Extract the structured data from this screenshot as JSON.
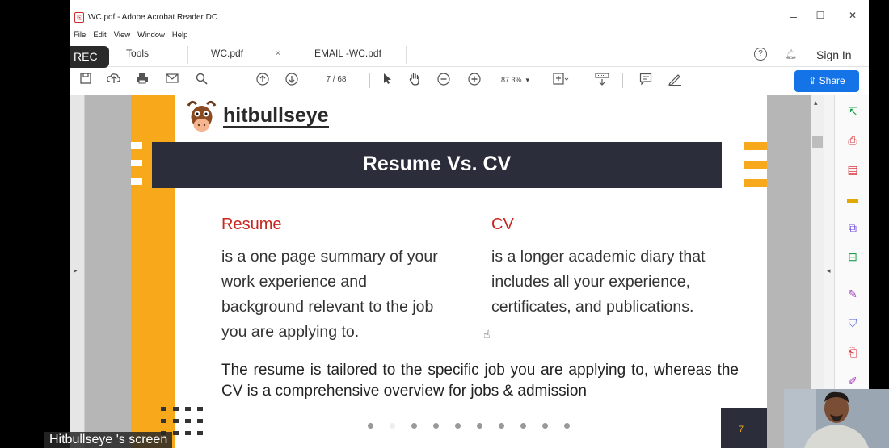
{
  "window": {
    "title": "WC.pdf - Adobe Acrobat Reader DC",
    "menu": [
      "File",
      "Edit",
      "View",
      "Window",
      "Help"
    ],
    "minimize_glyph": "–",
    "maximize_glyph": "☐",
    "close_glyph": "✕"
  },
  "recording": {
    "label": "REC"
  },
  "tabs": {
    "tools_label": "Tools",
    "items": [
      {
        "label": "WC.pdf",
        "close": "×"
      },
      {
        "label": "EMAIL -WC.pdf"
      }
    ],
    "help_glyph": "?",
    "sign_in": "Sign In"
  },
  "toolbar": {
    "page_current": "7",
    "page_total": "/ 68",
    "zoom": "87.3%",
    "share_label": "Share",
    "icons": [
      "save-icon",
      "upload-icon",
      "print-icon",
      "email-icon",
      "search-icon",
      "prev-page-icon",
      "next-page-icon",
      "select-cursor-icon",
      "hand-icon",
      "zoom-out-icon",
      "zoom-in-icon",
      "fit-page-icon",
      "scroll-mode-icon",
      "comment-icon",
      "pen-icon"
    ]
  },
  "document": {
    "brand": "hitbullseye",
    "banner_title": "Resume Vs. CV",
    "left_heading": "Resume",
    "left_lines": [
      "is a one page summary of your",
      "work experience and",
      "background relevant to the job",
      "you are applying to."
    ],
    "right_heading": "CV",
    "right_lines": [
      "is a longer academic diary that",
      "includes all your experience,",
      "certificates, and publications."
    ],
    "summary": "The resume is tailored to the specific job you are applying to, whereas the CV is a comprehensive overview for jobs & admission",
    "page_number": "7",
    "pager_dots": 10,
    "pager_active": 1,
    "colors": {
      "accent_orange": "#f7a81b",
      "banner_dark": "#2b2d3a",
      "heading_red": "#c8261f"
    }
  },
  "right_panel": {
    "icons": [
      "export-pdf-icon",
      "create-pdf-icon",
      "organize-pages-icon",
      "comment-tool-icon",
      "combine-files-icon",
      "edit-pdf-icon",
      "fill-sign-icon",
      "protect-icon",
      "compress-pdf-icon",
      "more-tools-icon"
    ]
  },
  "overlay": {
    "screen_share_label": "Hitbullseye 's screen"
  }
}
